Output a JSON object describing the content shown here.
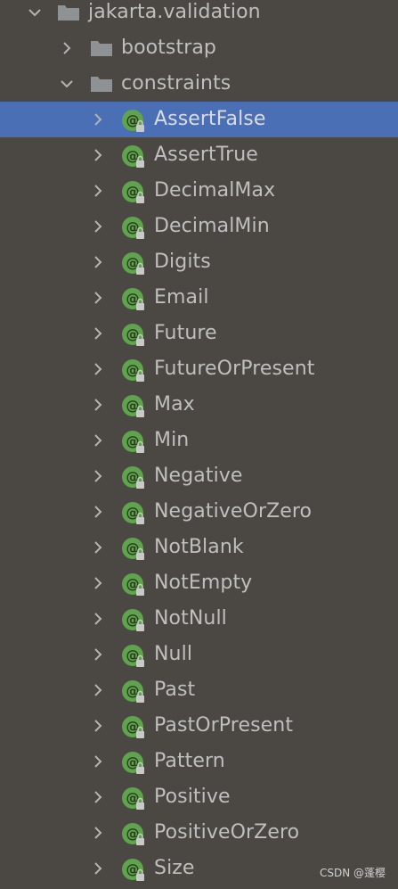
{
  "tree": {
    "root": {
      "label": "jakarta.validation",
      "expanded": true,
      "icon": "folder-icon"
    },
    "folders": [
      {
        "label": "bootstrap",
        "expanded": false,
        "icon": "folder-icon"
      },
      {
        "label": "constraints",
        "expanded": true,
        "icon": "folder-icon"
      }
    ],
    "annotations": [
      {
        "label": "AssertFalse",
        "selected": true
      },
      {
        "label": "AssertTrue"
      },
      {
        "label": "DecimalMax"
      },
      {
        "label": "DecimalMin"
      },
      {
        "label": "Digits"
      },
      {
        "label": "Email"
      },
      {
        "label": "Future"
      },
      {
        "label": "FutureOrPresent"
      },
      {
        "label": "Max"
      },
      {
        "label": "Min"
      },
      {
        "label": "Negative"
      },
      {
        "label": "NegativeOrZero"
      },
      {
        "label": "NotBlank"
      },
      {
        "label": "NotEmpty"
      },
      {
        "label": "NotNull"
      },
      {
        "label": "Null"
      },
      {
        "label": "Past"
      },
      {
        "label": "PastOrPresent"
      },
      {
        "label": "Pattern"
      },
      {
        "label": "Positive"
      },
      {
        "label": "PositiveOrZero"
      },
      {
        "label": "Size"
      }
    ],
    "annotation_icon": "annotation-lock-icon"
  },
  "colors": {
    "background": "#4b4742",
    "selection": "#4a6fb5",
    "text": "#bfbfbf",
    "annotation_icon": "#5fa34c",
    "folder": "#8e9295"
  },
  "watermark": "CSDN @蓬樱"
}
